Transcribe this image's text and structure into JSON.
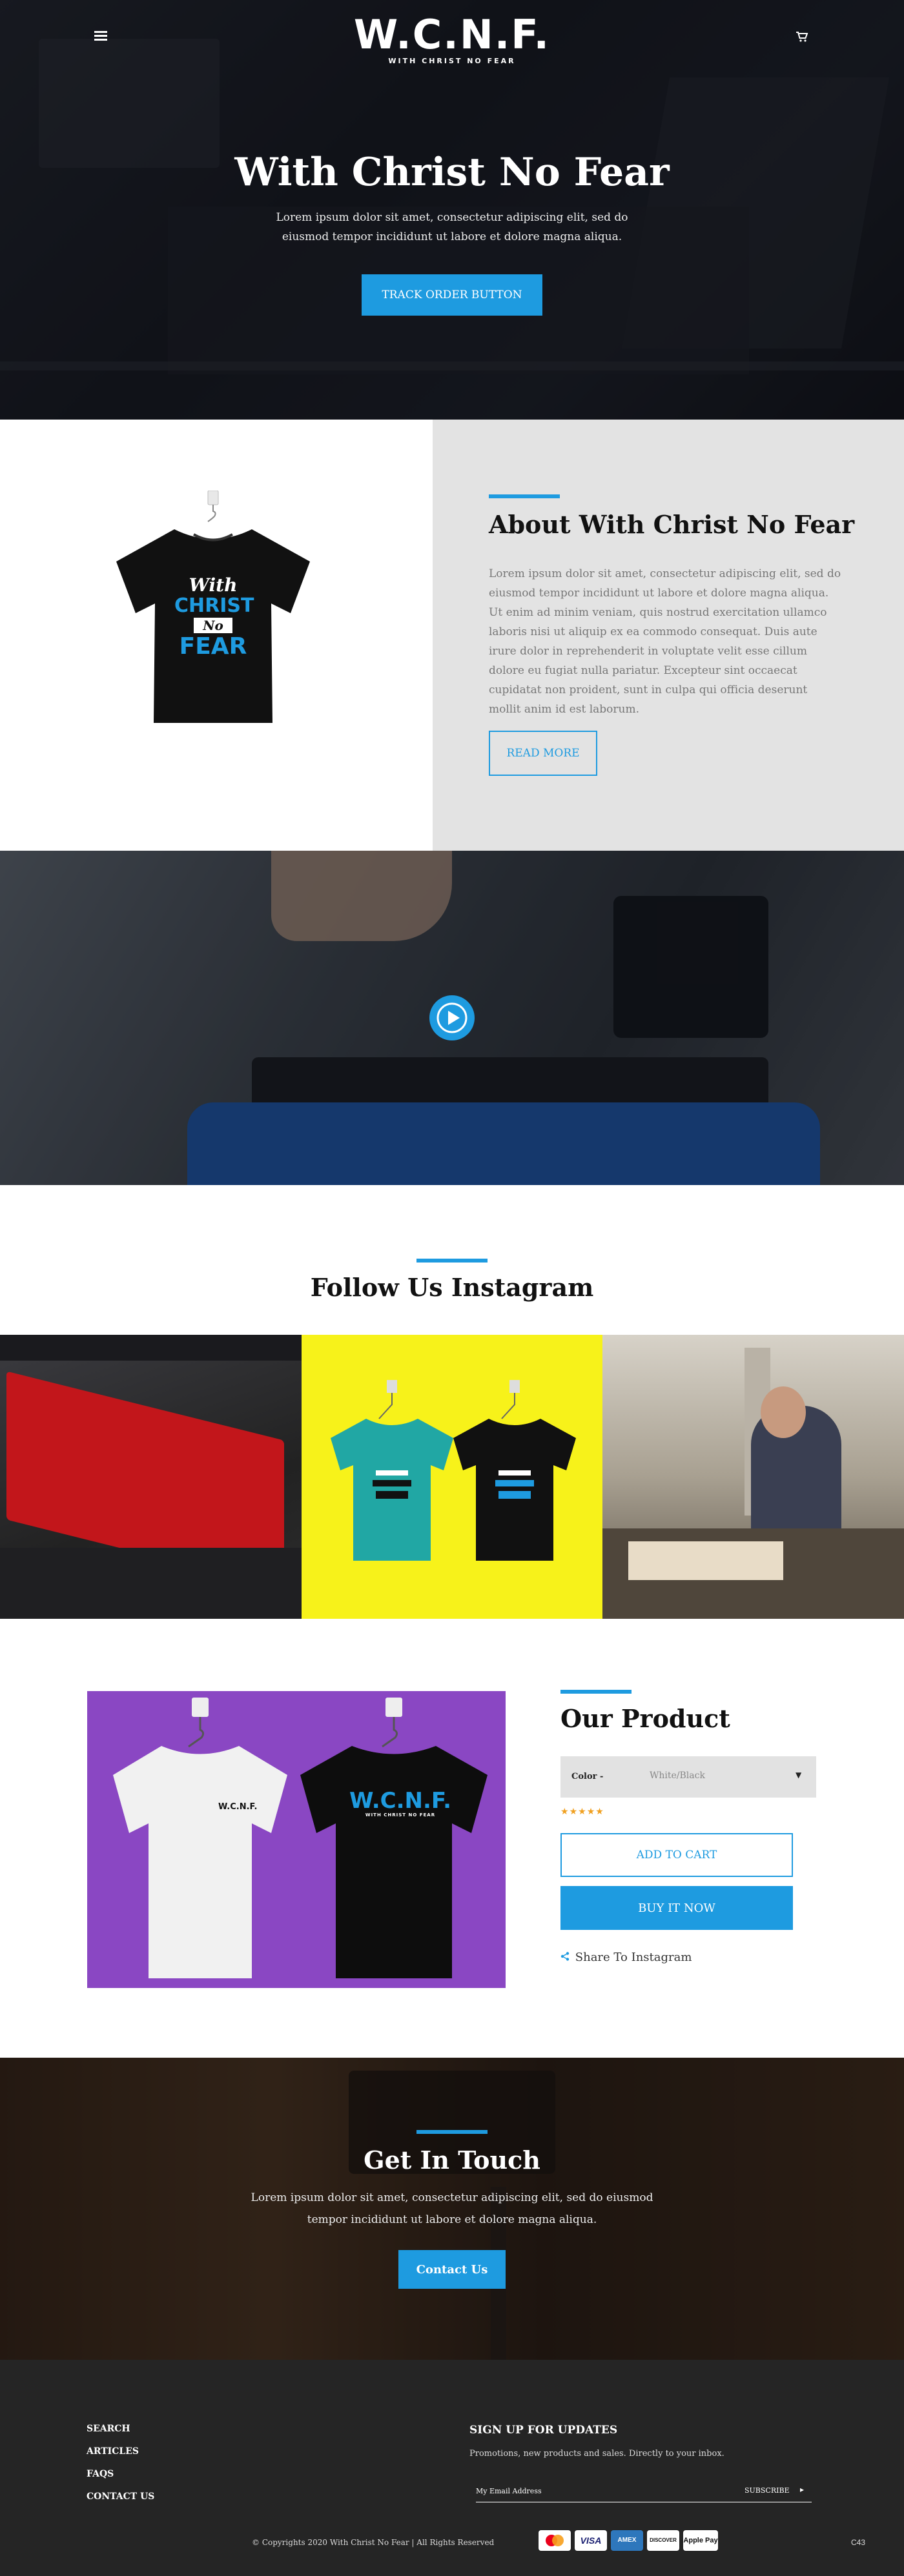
{
  "header": {
    "logo_main": "W.C.N.F.",
    "logo_tagline": "WITH CHRIST NO FEAR"
  },
  "hero": {
    "title": "With Christ No Fear",
    "text": "Lorem ipsum dolor sit amet, consectetur adipiscing elit, sed do eiusmod tempor incididunt ut labore et dolore magna aliqua.",
    "button": "TRACK ORDER BUTTON"
  },
  "about": {
    "title": "About With Christ No Fear",
    "text": "Lorem ipsum dolor sit amet, consectetur adipiscing elit, sed do eiusmod tempor incididunt ut labore et dolore magna aliqua. Ut enim ad minim veniam, quis nostrud exercitation ullamco laboris nisi ut aliquip ex ea commodo consequat. Duis aute irure dolor in reprehenderit in voluptate velit esse cillum dolore eu fugiat nulla pariatur. Excepteur sint occaecat cupidatat non proident, sunt in culpa qui officia deserunt mollit anim id est laborum.",
    "button": "READ MORE",
    "shirt_text": [
      "With",
      "CHRIST",
      "No",
      "FEAR"
    ]
  },
  "instagram": {
    "title": "Follow Us Instagram"
  },
  "product": {
    "title": "Our Product",
    "color_label": "Color -",
    "color_value": "White/Black",
    "rating": 5,
    "add_to_cart": "ADD TO CART",
    "buy_now": "BUY IT NOW",
    "share": "Share To Instagram",
    "white_shirt_logo": "W.C.N.F.",
    "black_shirt_logo": "W.C.N.F.",
    "black_shirt_tagline": "WITH CHRIST NO FEAR"
  },
  "contact": {
    "title": "Get In Touch",
    "text": "Lorem ipsum dolor sit amet, consectetur adipiscing elit, sed do eiusmod tempor incididunt ut labore et dolore magna aliqua.",
    "button": "Contact Us"
  },
  "footer": {
    "nav": [
      "SEARCH",
      "ARTICLES",
      "FAQS",
      "CONTACT US"
    ],
    "signup_title": "SIGN UP FOR UPDATES",
    "signup_text": "Promotions, new products and sales. Directly to your inbox.",
    "email_placeholder": "My Email Address",
    "subscribe": "SUBSCRIBE",
    "copyright": "© Copyrights 2020 With Christ No Fear  |  All Rights Reserved",
    "payment_cards": [
      "mastercard",
      "VISA",
      "AMEX",
      "DISCOVER",
      "Apple Pay"
    ],
    "code": "C43"
  },
  "colors": {
    "accent": "#1e9be0",
    "about_panel": "#e3e3e3",
    "product_bg": "#8a47c3",
    "instagram_yellow": "#f7f21a",
    "footer_bg": "#252525"
  }
}
